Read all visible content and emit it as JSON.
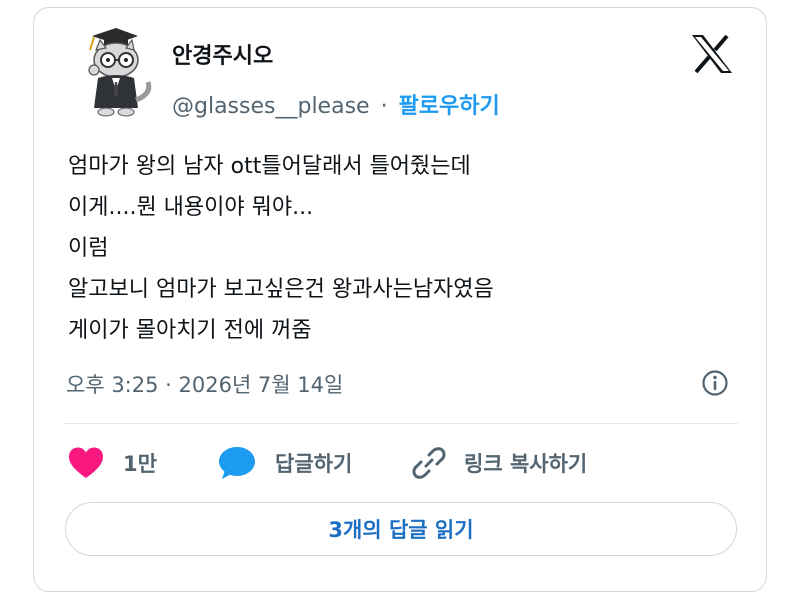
{
  "user": {
    "display_name": "안경주시오",
    "handle": "@glasses__please",
    "separator": "·",
    "follow_label": "팔로우하기",
    "avatar_icon": "cat-with-glasses-avatar"
  },
  "platform_icon": "x-logo-icon",
  "tweet": {
    "lines": [
      "엄마가 왕의 남자 ott틀어달래서 틀어줬는데",
      "이게....뭔 내용이야 뭐야...",
      "이럼",
      "알고보니 엄마가 보고싶은건 왕과사는남자였음",
      "게이가 몰아치기 전에 꺼줌"
    ]
  },
  "meta": {
    "timestamp": "오후 3:25 · 2026년 7월 14일",
    "info_icon": "info-icon"
  },
  "actions": {
    "like_count": "1만",
    "reply_label": "답글하기",
    "copy_link_label": "링크 복사하기"
  },
  "read_replies_label": "3개의 답글 읽기",
  "colors": {
    "accent": "#1d9bf0",
    "heart": "#f91880",
    "text": "#0f1419",
    "muted": "#536471",
    "border": "#cfd9de"
  }
}
